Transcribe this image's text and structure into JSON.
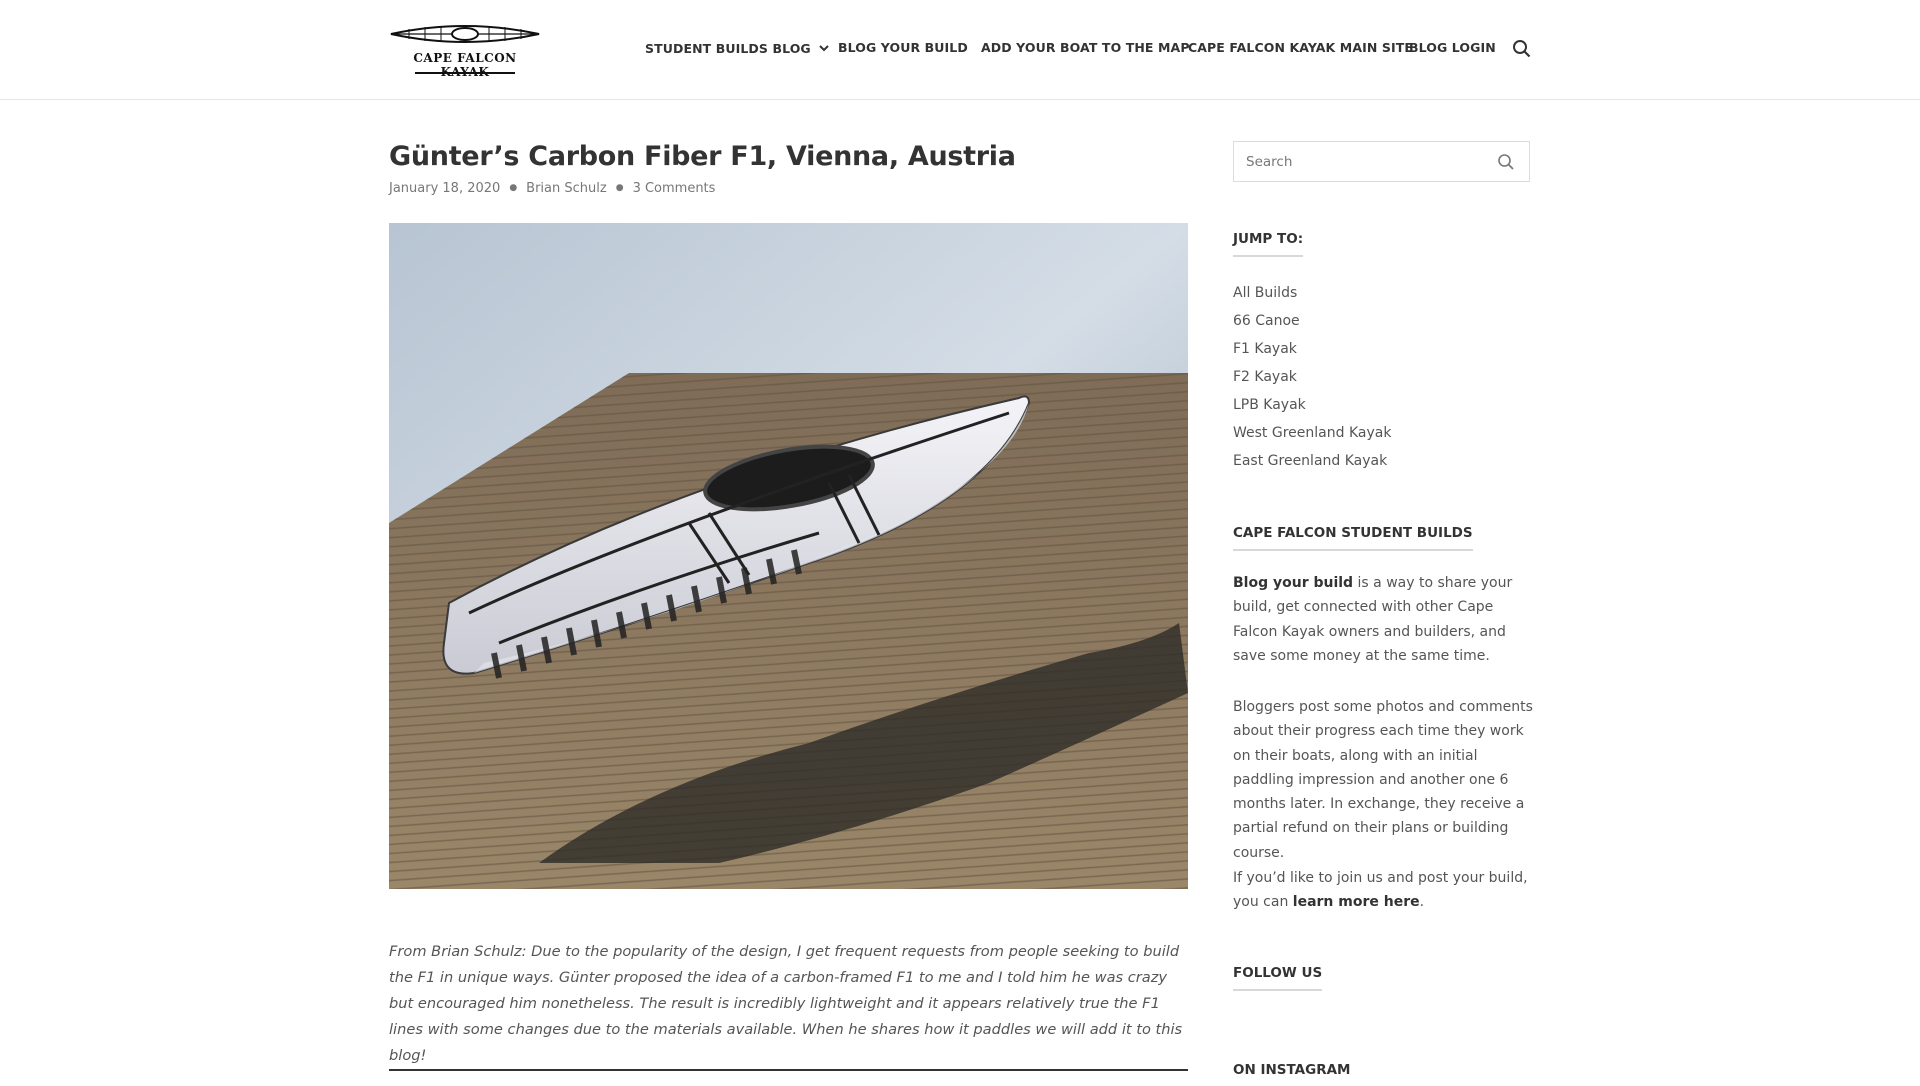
{
  "header": {
    "logo_text": "CAPE FALCON KAYAK",
    "nav": [
      {
        "label": "STUDENT BUILDS BLOG",
        "has_dropdown": true
      },
      {
        "label": "BLOG YOUR BUILD"
      },
      {
        "label": "ADD YOUR BOAT TO THE MAP"
      },
      {
        "label": "CAPE FALCON KAYAK MAIN SITE"
      },
      {
        "label": "BLOG LOGIN"
      }
    ],
    "search_icon": "search-icon"
  },
  "post": {
    "title": "Günter’s Carbon Fiber F1, Vienna, Austria",
    "date": "January 18, 2020",
    "author": "Brian Schulz",
    "comments": "3 Comments",
    "excerpt": "From Brian Schulz:  Due to the popularity of the design, I get frequent requests from people seeking to build the F1 in unique ways. Günter proposed the idea of a carbon-framed F1 to me and I told him he was crazy but encouraged him nonetheless. The result is incredibly lightweight and it appears relatively true the F1 lines with some changes due to the materials available.  When he shares how it paddles we will add it to this blog!"
  },
  "sidebar": {
    "search_placeholder": "Search",
    "jump_title": "JUMP TO:",
    "jump_items": [
      "All Builds",
      "66 Canoe",
      "F1 Kayak",
      "F2 Kayak",
      "LPB Kayak",
      "West Greenland Kayak",
      "East Greenland Kayak"
    ],
    "builds_title": "CAPE FALCON STUDENT BUILDS",
    "para1_bold": "Blog your build",
    "para1_rest": " is a way to share your build, get connected with other Cape Falcon Kayak owners and builders, and save some money at the same time.",
    "para2": "Bloggers post some photos and comments about their progress each time they work on their boats, along with an initial paddling impression and another one 6 months later. In exchange, they receive a partial refund on their plans or building course.",
    "para3_start": "If you’d like to join us and post your build, you can ",
    "para3_link": "learn more here",
    "para3_end": ".",
    "follow_title": "FOLLOW US",
    "instagram_title": "ON INSTAGRAM"
  },
  "colors": {
    "text": "#333333",
    "muted": "#777777",
    "border": "#dcdcdc"
  }
}
